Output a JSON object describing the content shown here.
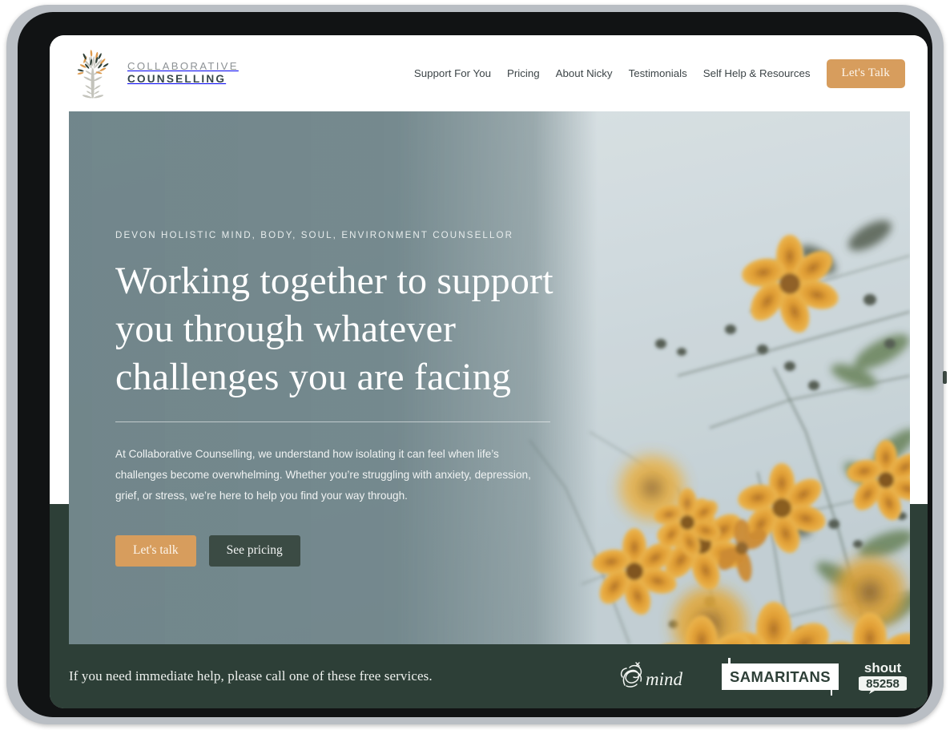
{
  "brand": {
    "line1": "COLLABORATIVE",
    "line2": "COUNSELLING",
    "logo_icon": "tree-icon"
  },
  "nav": {
    "items": [
      {
        "label": "Support For You"
      },
      {
        "label": "Pricing"
      },
      {
        "label": "About Nicky"
      },
      {
        "label": "Testimonials"
      },
      {
        "label": "Self Help & Resources"
      }
    ],
    "cta_label": "Let's Talk"
  },
  "hero": {
    "eyebrow": "DEVON HOLISTIC MIND, BODY, SOUL, ENVIRONMENT COUNSELLOR",
    "title": "Working together to support you through whatever challenges you are facing",
    "paragraph": "At Collaborative Counselling, we understand how isolating it can feel when life’s challenges become overwhelming. Whether you’re struggling with anxiety, depression, grief, or stress, we’re here to help you find your way through.",
    "primary_cta": "Let's talk",
    "secondary_cta": "See pricing",
    "image_alt": "orange-cosmos-flowers-photo"
  },
  "footer": {
    "message": "If you need immediate help, please call one of these free services.",
    "logos": [
      {
        "name": "mind-logo",
        "label": "mind"
      },
      {
        "name": "samaritans-logo",
        "label": "SAMARITANS"
      },
      {
        "name": "shout-logo",
        "label": "shout",
        "sub_label": "85258"
      }
    ]
  },
  "colors": {
    "accent_orange": "#d79d5d",
    "dark_green": "#2d3f37",
    "hero_overlay": "#6e8388",
    "brand_dark": "#37474a"
  }
}
